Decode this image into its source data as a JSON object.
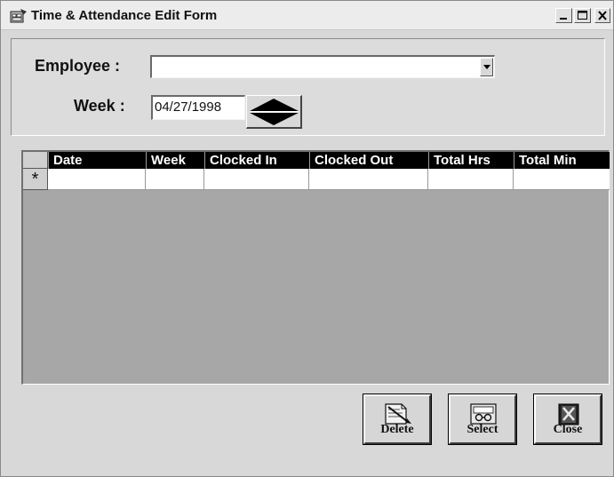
{
  "window": {
    "title": "Time & Attendance Edit Form"
  },
  "form": {
    "employee_label": "Employee :",
    "employee_value": "",
    "week_label": "Week :",
    "week_value": "04/27/1998"
  },
  "grid": {
    "columns": [
      "Date",
      "Week",
      "Clocked In",
      "Clocked Out",
      "Total Hrs",
      "Total Min"
    ],
    "new_row_marker": "*"
  },
  "buttons": {
    "delete_label": "Delete",
    "select_label": "Select",
    "close_label": "Close"
  },
  "icons": {
    "app": "form-window-icon",
    "delete": "delete-doc-icon",
    "select": "select-record-icon",
    "close": "close-door-icon"
  }
}
